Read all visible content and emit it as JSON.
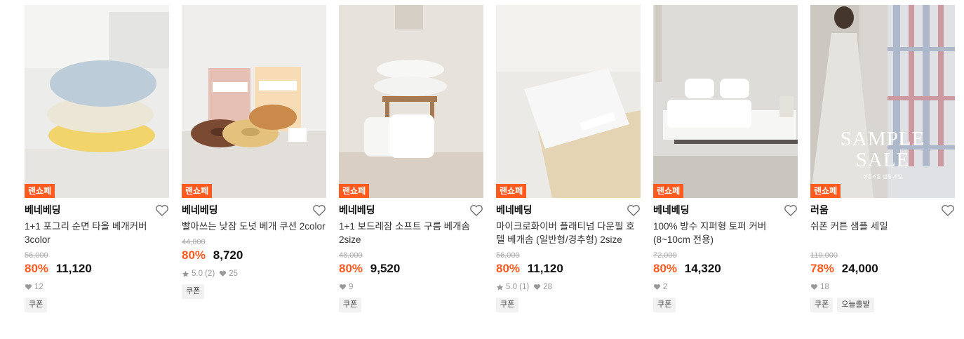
{
  "products": [
    {
      "badge": "랜쇼페",
      "brand": "베네베딩",
      "title": "1+1 포그리 순면 타올 베개커버 3color",
      "original_price": "56,000",
      "discount": "80%",
      "price": "11,120",
      "likes": "12",
      "tags": [
        "쿠폰"
      ],
      "image": "pillow-stack"
    },
    {
      "badge": "랜쇼페",
      "brand": "베네베딩",
      "title": "빨아쓰는 낮잠 도넛 베개 쿠션 2color",
      "original_price": "44,000",
      "discount": "80%",
      "price": "8,720",
      "rating": "5.0 (2)",
      "likes": "25",
      "tags": [
        "쿠폰"
      ],
      "image": "donut-cushions"
    },
    {
      "badge": "랜쇼페",
      "brand": "베네베딩",
      "title": "1+1 보드레잠 소프트 구름 베개솜 2size",
      "original_price": "48,000",
      "discount": "80%",
      "price": "9,520",
      "likes": "9",
      "tags": [
        "쿠폰"
      ],
      "image": "white-pillows"
    },
    {
      "badge": "랜쇼페",
      "brand": "베네베딩",
      "title": "마이크로화이버 플래티넘 다운필 호텔 베개솜 (일반형/경추형) 2size",
      "original_price": "56,000",
      "discount": "80%",
      "price": "11,120",
      "rating": "5.0 (1)",
      "likes": "28",
      "tags": [
        "쿠폰"
      ],
      "image": "platinum-pillow"
    },
    {
      "badge": "랜쇼페",
      "brand": "베네베딩",
      "title": "100% 방수 지퍼형 토퍼 커버 (8~10cm 전용)",
      "original_price": "72,000",
      "discount": "80%",
      "price": "14,320",
      "likes": "2",
      "tags": [
        "쿠폰"
      ],
      "image": "bed-topper"
    },
    {
      "badge": "랜쇼페",
      "brand": "러움",
      "title": "쉬폰 커튼 샘플 세일",
      "original_price": "110,000",
      "discount": "78%",
      "price": "24,000",
      "likes": "18",
      "tags": [
        "쿠폰",
        "오늘출발"
      ],
      "image": "curtain-sample",
      "image_text": {
        "line1": "SAMPLE",
        "line2": "SALE",
        "caption": "쉬폰커튼 샘플 세일"
      }
    }
  ],
  "colors": {
    "accent": "#ff5a1f",
    "text": "#111111",
    "muted": "#999999"
  },
  "icons": {
    "like": "heart-outline-icon",
    "heart_small": "heart-filled-icon",
    "star": "star-icon"
  }
}
